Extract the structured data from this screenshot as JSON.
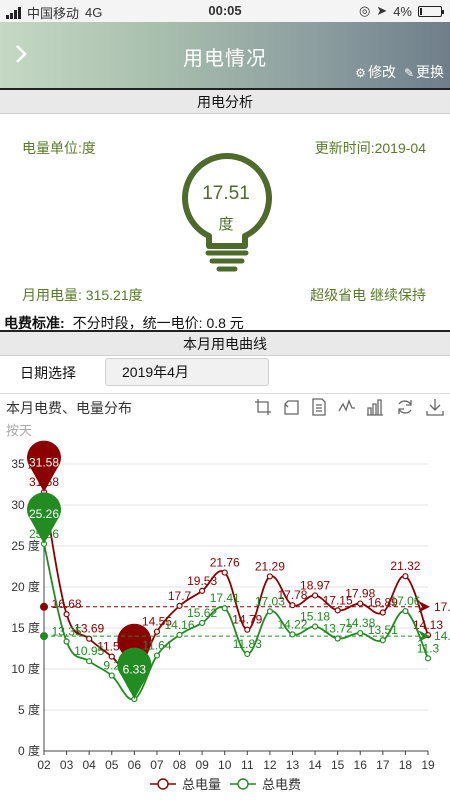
{
  "status_bar": {
    "carrier": "中国移动",
    "network": "4G",
    "time": "00:05",
    "battery": "4%"
  },
  "header": {
    "back_icon": "chevron-right-icon",
    "title": "用电情况",
    "modify_label": "修改",
    "change_label": "更换"
  },
  "analysis": {
    "section_title": "用电分析",
    "unit_label": "电量单位:度",
    "update_time": "更新时间:2019-04",
    "bulb_value": "17.51",
    "bulb_unit": "度",
    "monthly_usage": "月用电量:  315.21度",
    "tip": "超级省电 继续保持"
  },
  "tariff": {
    "label": "电费标准:",
    "value": "不分时段，统一电价:  0.8  元"
  },
  "curve": {
    "section_title": "本月用电曲线",
    "date_label": "日期选择",
    "date_value": "2019年4月"
  },
  "chart_data": {
    "type": "line",
    "title": "本月电费、电量分布",
    "subtitle": "按天",
    "ylim": [
      0,
      35
    ],
    "y_ticks": [
      "0 度",
      "5 度",
      "10 度",
      "15 度",
      "20 度",
      "25 度",
      "30 度",
      "35 度"
    ],
    "x": [
      "02",
      "03",
      "04",
      "05",
      "06",
      "07",
      "08",
      "09",
      "10",
      "11",
      "12",
      "13",
      "14",
      "15",
      "16",
      "17",
      "18",
      "19"
    ],
    "grid": true,
    "legend": "bottom",
    "series": [
      {
        "name": "总电量",
        "color": "#8b0000",
        "values": [
          31.58,
          16.68,
          13.69,
          11.51,
          9.25,
          14.55,
          17.7,
          19.53,
          21.76,
          14.79,
          21.29,
          17.78,
          18.97,
          17.15,
          17.98,
          16.89,
          21.32,
          14.13
        ],
        "labels": [
          "31.58",
          "16.68",
          "13.69",
          "11.51",
          "",
          "14.55",
          "17.7",
          "19.53",
          "21.76",
          "14.79",
          "21.29",
          "17.78",
          "18.97",
          "17.15",
          "17.98",
          "16.89",
          "21.32",
          "14.13"
        ],
        "max_marker": "31.58",
        "min_marker": "",
        "average": "17."
      },
      {
        "name": "总电费",
        "color": "#228b22",
        "values": [
          25.26,
          13.35,
          10.95,
          9.2,
          6.33,
          11.64,
          14.16,
          15.62,
          17.41,
          11.83,
          17.03,
          14.22,
          15.18,
          13.72,
          14.38,
          13.51,
          17.06,
          11.3
        ],
        "labels": [
          "25.26",
          "13.35",
          "10.95",
          "9.2",
          "",
          "11.64",
          "14.16",
          "15.62",
          "17.41",
          "11.83",
          "17.03",
          "14.22",
          "15.18",
          "13.72",
          "14.38",
          "13.51",
          "17.06",
          "11.3"
        ],
        "max_marker": "25.26",
        "min_marker": "6.33",
        "average": "14."
      }
    ]
  }
}
